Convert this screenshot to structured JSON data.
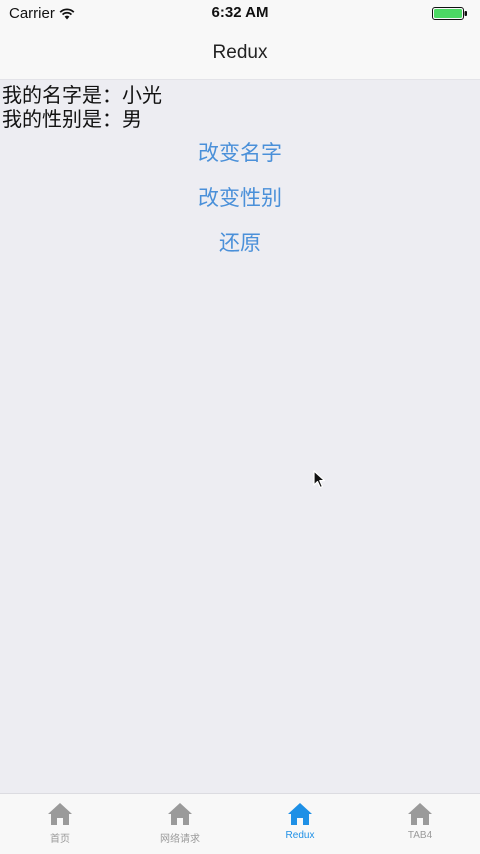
{
  "status_bar": {
    "carrier": "Carrier",
    "time": "6:32 AM",
    "battery_level": 1.0,
    "battery_color": "#4cd964"
  },
  "nav": {
    "title": "Redux"
  },
  "content": {
    "name_line": "我的名字是：小光",
    "gender_line": "我的性别是：男",
    "buttons": {
      "change_name": "改变名字",
      "change_gender": "改变性别",
      "reset": "还原"
    },
    "button_color": "#4a90d9"
  },
  "tab_bar": {
    "active_color": "#1e90e6",
    "inactive_color": "#9a9a9a",
    "tabs": [
      {
        "label": "首页",
        "icon": "home-icon",
        "active": false
      },
      {
        "label": "网络请求",
        "icon": "home-icon",
        "active": false
      },
      {
        "label": "Redux",
        "icon": "home-icon",
        "active": true
      },
      {
        "label": "TAB4",
        "icon": "home-icon",
        "active": false
      }
    ]
  }
}
